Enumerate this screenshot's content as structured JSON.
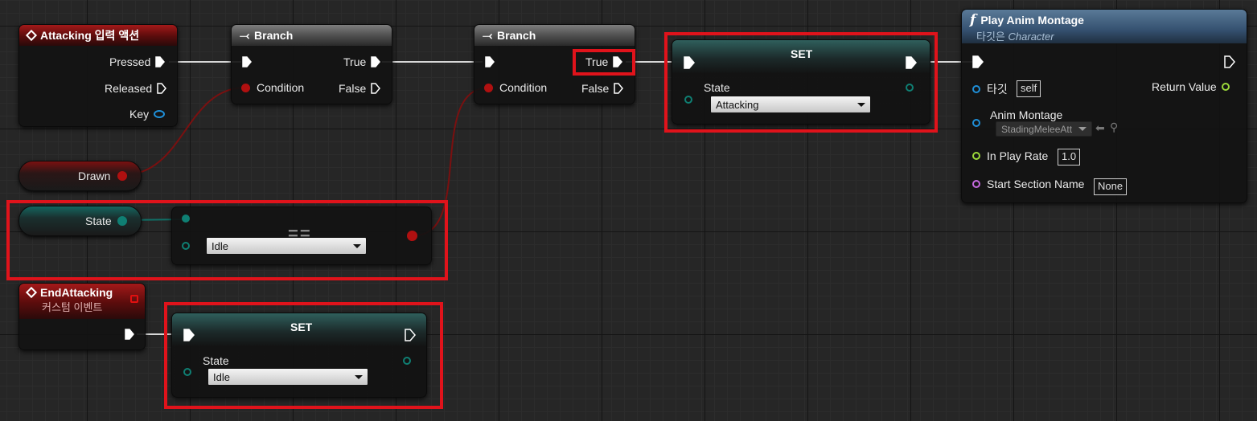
{
  "colors": {
    "exec": "#ffffff",
    "bool": "#b01010",
    "enum": "#0f7f73",
    "object": "#1f8fd8",
    "float": "#9cd93a",
    "name": "#c66adf",
    "highlight": "#e0131b"
  },
  "nodes": {
    "attacking_event": {
      "title": "Attacking 입력 액션",
      "icon": "diamond-event-icon",
      "pins": {
        "pressed": "Pressed",
        "released": "Released",
        "key": "Key"
      }
    },
    "branch1": {
      "title": "Branch",
      "icon": "branch-icon",
      "pins": {
        "condition": "Condition",
        "true": "True",
        "false": "False"
      }
    },
    "branch2": {
      "title": "Branch",
      "icon": "branch-icon",
      "pins": {
        "condition": "Condition",
        "true": "True",
        "false": "False"
      }
    },
    "set_attacking": {
      "title": "SET",
      "var_label": "State",
      "value": "Attacking"
    },
    "play_anim": {
      "title": "Play Anim Montage",
      "subtitle_prefix": "타깃은",
      "subtitle_target": "Character",
      "icon": "function-icon",
      "pins": {
        "target_label": "타깃",
        "target_value": "self",
        "return_value": "Return Value",
        "anim_montage": "Anim Montage",
        "anim_montage_value": "StadingMeleeAtt",
        "in_play_rate": "In Play Rate",
        "in_play_rate_value": "1.0",
        "start_section": "Start Section Name",
        "start_section_value": "None"
      }
    },
    "drawn_var": {
      "label": "Drawn"
    },
    "state_var": {
      "label": "State"
    },
    "equal_node": {
      "title": "==",
      "value": "Idle"
    },
    "end_attacking": {
      "title": "EndAttacking",
      "subtitle": "커스텀 이벤트",
      "icon": "diamond-event-icon"
    },
    "set_idle": {
      "title": "SET",
      "var_label": "State",
      "value": "Idle"
    }
  }
}
